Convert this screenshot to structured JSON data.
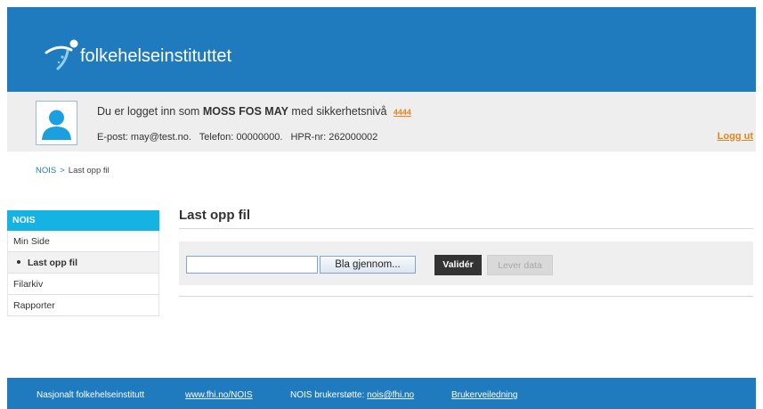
{
  "header": {
    "logo_text": "folkehelseinstituttet",
    "brand_color": "#1f7bbd"
  },
  "user": {
    "login_prefix": "Du er logget inn som",
    "name": "MOSS FOS MAY",
    "login_suffix": "med sikkerhetsnivå",
    "security_level": "4444",
    "email": "E-post: may@test.no.",
    "phone": "Telefon: 00000000.",
    "hpr": "HPR-nr: 262000002",
    "logout_label": "Logg ut",
    "avatar_icon": "user-avatar-icon"
  },
  "breadcrumb": {
    "root": "NOIS",
    "separator": ">",
    "current": "Last opp fil"
  },
  "sidebar": {
    "heading": "NOIS",
    "items": [
      {
        "label": "Min Side",
        "active": false
      },
      {
        "label": "Last opp fil",
        "active": true
      },
      {
        "label": "Filarkiv",
        "active": false
      },
      {
        "label": "Rapporter",
        "active": false
      }
    ]
  },
  "main": {
    "title": "Last opp fil",
    "file_value": "",
    "browse_label": "Bla gjennom...",
    "validate_label": "Validér",
    "deliver_label": "Lever data"
  },
  "footer": {
    "org": "Nasjonalt folkehelseinstitutt",
    "link1": "www.fhi.no/NOIS",
    "support_prefix": "NOIS brukerstøtte:",
    "support_email": "nois@fhi.no",
    "guide": "Brukerveiledning"
  }
}
